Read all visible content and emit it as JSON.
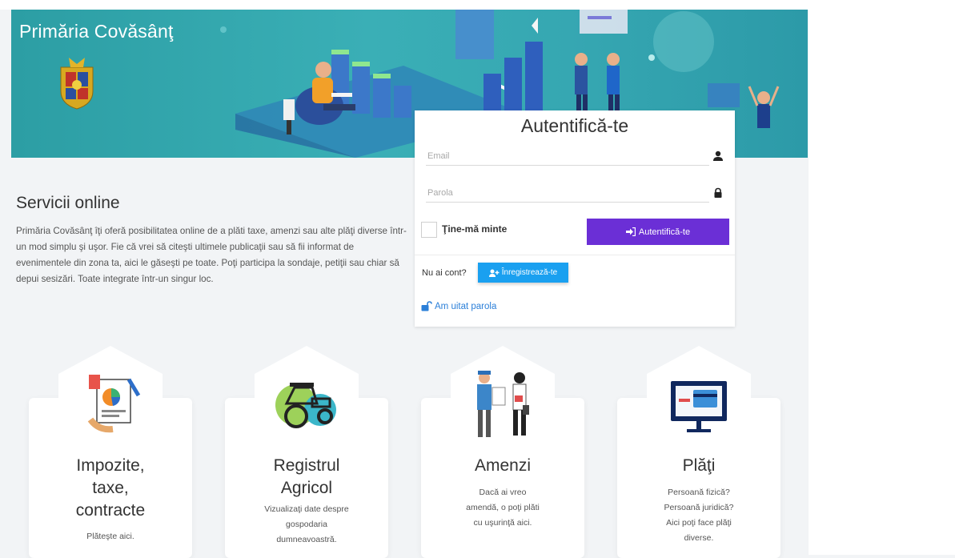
{
  "header": {
    "title": "Primăria Covăsânţ"
  },
  "services": {
    "title": "Servicii online",
    "description": "Primăria Covăsânţ îţi oferă posibilitatea online de a plăti taxe, amenzi sau alte plăţi diverse într-un mod simplu şi uşor. Fie că vrei să citeşti ultimele publicaţii sau să fii informat de evenimentele din zona ta, aici le găseşti pe toate. Poţi participa la sondaje, petiţii sau chiar să depui sesizări. Toate integrate într-un singur loc."
  },
  "login": {
    "title": "Autentifică-te",
    "email_placeholder": "Email",
    "password_placeholder": "Parola",
    "remember_label": "Ţine-mă minte",
    "submit_label": "Autentifică-te",
    "no_account_label": "Nu ai cont?",
    "register_label": "Înregistrează-te",
    "forgot_label": "Am uitat parola"
  },
  "cards": [
    {
      "title": "Impozite, taxe, contracte",
      "description": "Plăteşte aici."
    },
    {
      "title": "Registrul Agricol",
      "description": "Vizualizaţi date despre gospodaria dumneavoastră."
    },
    {
      "title": "Amenzi",
      "description": "Dacă ai vreo amendă, o poţi plăti cu uşurinţă aici."
    },
    {
      "title": "Plăţi",
      "description": "Persoană fizică? Persoană juridică? Aici poţi face plăţi diverse."
    }
  ],
  "colors": {
    "banner": "#36a9b0",
    "primary": "#6b2fd6",
    "register": "#1aa0f0",
    "link": "#2b7fd8"
  }
}
